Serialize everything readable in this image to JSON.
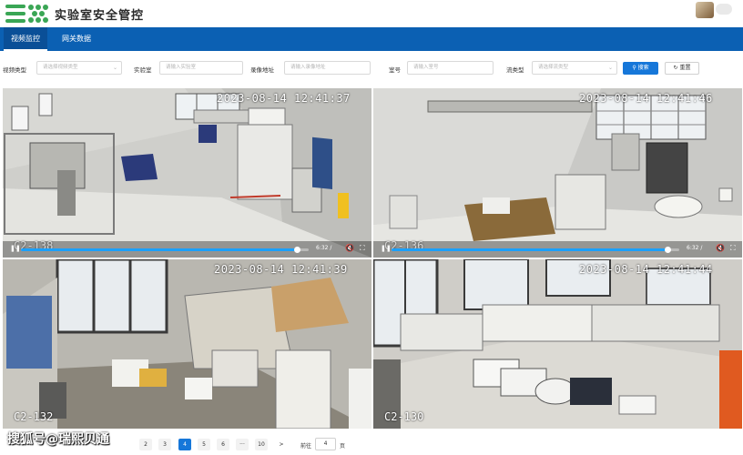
{
  "header": {
    "title": "实验室安全管控"
  },
  "nav": {
    "tabs": [
      {
        "label": "视频监控",
        "active": true
      },
      {
        "label": "网关数据",
        "active": false
      }
    ]
  },
  "filters": [
    {
      "label": "视频类型",
      "placeholder": "请选择视频类型",
      "type": "select"
    },
    {
      "label": "实验室",
      "placeholder": "请输入实验室",
      "type": "input"
    },
    {
      "label": "录像地址",
      "placeholder": "请输入录像地址",
      "type": "input"
    },
    {
      "label": "室号",
      "placeholder": "请输入室号",
      "type": "input"
    },
    {
      "label": "流类型",
      "placeholder": "请选择流类型",
      "type": "select"
    }
  ],
  "buttons": {
    "search": "搜索",
    "reset": "重置"
  },
  "cameras": [
    {
      "label": "C2-138",
      "timestamp": "2023-08-14 12:41:37",
      "duration": "6:32 /",
      "progress": 0.96,
      "controls_visible": true
    },
    {
      "label": "C2-136",
      "timestamp": "2023-08-14 12:41:46",
      "duration": "6:32 /",
      "progress": 0.96,
      "controls_visible": true
    },
    {
      "label": "C2-132",
      "timestamp": "2023-08-14 12:41:39",
      "controls_visible": false
    },
    {
      "label": "C2-130",
      "timestamp": "2023-08-14 12:41:44",
      "controls_visible": false
    }
  ],
  "pagination": {
    "pages": [
      "2",
      "3",
      "4",
      "5",
      "6",
      "···",
      "10",
      ">"
    ],
    "active": "4",
    "goto_label": "前往",
    "goto_value": "4",
    "goto_unit": "页"
  },
  "watermark": "搜狐号@瑞熙贝通",
  "colors": {
    "brand": "#0b60b3",
    "accent": "#1677d9",
    "logo": "#3aa655"
  }
}
